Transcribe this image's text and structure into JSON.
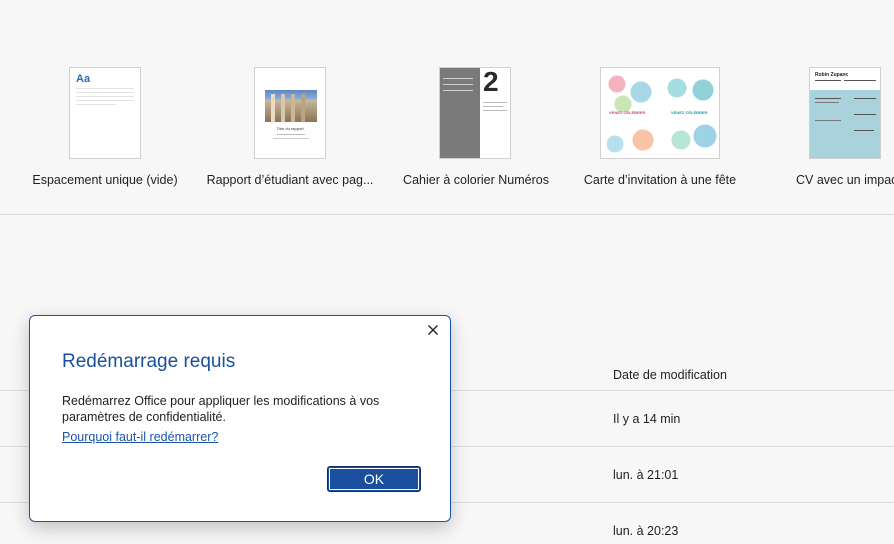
{
  "templates": [
    {
      "label": "Espacement unique (vide)",
      "thumb_text": "Aa"
    },
    {
      "label": "Rapport d’étudiant avec pag...",
      "thumb_text": "Titre du rapport"
    },
    {
      "label": "Cahier à colorier Numéros",
      "thumb_text": "2"
    },
    {
      "label": "Carte d’invitation à une fête",
      "thumb_text": "VENEZ CÉLÉBRER"
    },
    {
      "label": "CV avec un impact",
      "thumb_text": "Robin Zupanc"
    }
  ],
  "recent": {
    "column_header": "Date de modification",
    "rows": [
      {
        "date": "Il y a 14 min"
      },
      {
        "date": "lun. à 21:01"
      },
      {
        "date": "lun. à 20:23"
      }
    ]
  },
  "dialog": {
    "title": "Redémarrage requis",
    "message": "Redémarrez Office pour appliquer les modifications à vos paramètres de confidentialité.",
    "link": "Pourquoi faut-il redémarrer?",
    "ok_label": "OK"
  },
  "colors": {
    "accent": "#1a4f9e",
    "border": "#1a56a8"
  }
}
